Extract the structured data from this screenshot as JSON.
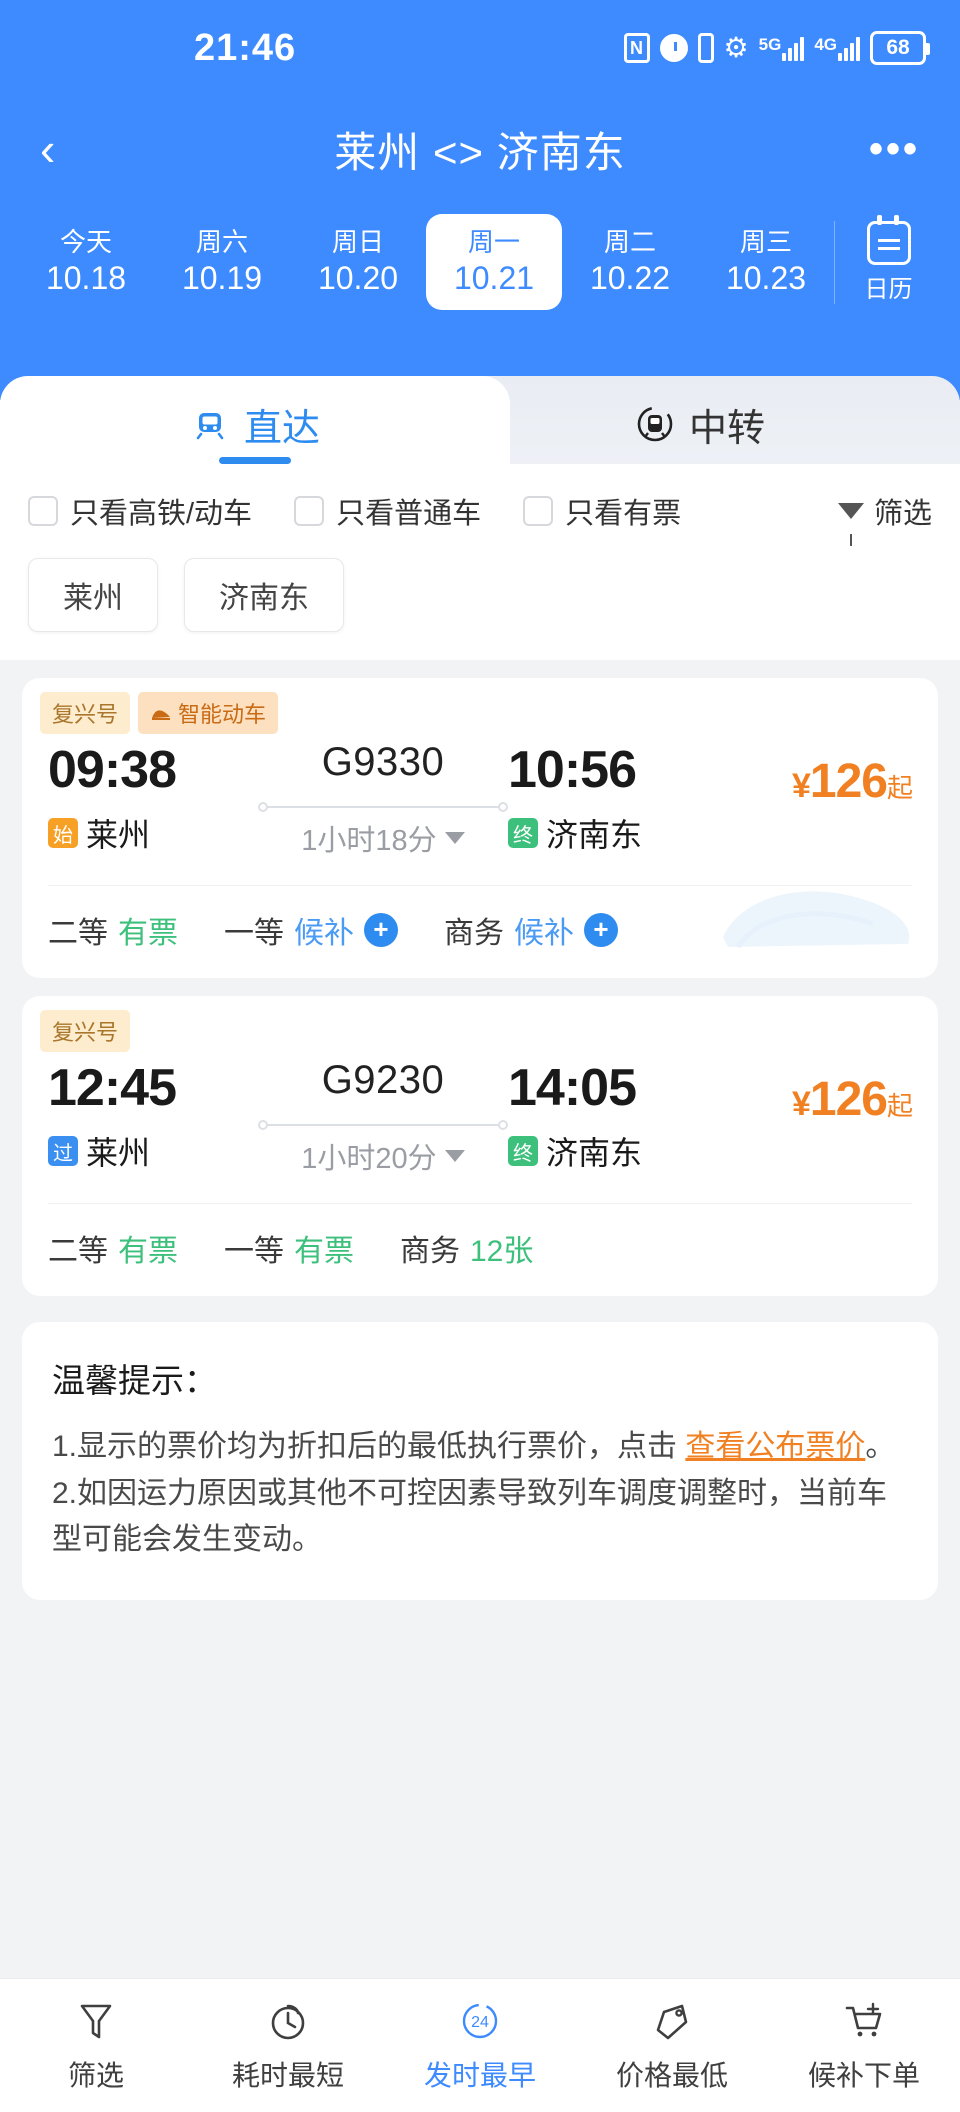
{
  "status_bar": {
    "time": "21:46",
    "battery": "68",
    "icons": [
      "nfc-icon",
      "alarm-icon",
      "vibrate-icon",
      "wifi-icon",
      "5g-signal-icon",
      "4g-signal-icon",
      "battery-icon"
    ],
    "net_5g": "5G",
    "net_4g": "4G"
  },
  "nav": {
    "back": "‹",
    "title": "莱州 <> 济南东",
    "more": "•••"
  },
  "dates": {
    "items": [
      {
        "week": "今天",
        "date": "10.18",
        "active": false
      },
      {
        "week": "周六",
        "date": "10.19",
        "active": false
      },
      {
        "week": "周日",
        "date": "10.20",
        "active": false
      },
      {
        "week": "周一",
        "date": "10.21",
        "active": true
      },
      {
        "week": "周二",
        "date": "10.22",
        "active": false
      },
      {
        "week": "周三",
        "date": "10.23",
        "active": false
      }
    ],
    "calendar_label": "日历"
  },
  "tabs": [
    {
      "label": "直达",
      "active": true
    },
    {
      "label": "中转",
      "active": false
    }
  ],
  "filters": {
    "checkboxes": [
      {
        "label": "只看高铁/动车",
        "checked": false
      },
      {
        "label": "只看普通车",
        "checked": false
      },
      {
        "label": "只看有票",
        "checked": false
      }
    ],
    "filter_label": "筛选"
  },
  "station_chips": [
    "莱州",
    "济南东"
  ],
  "trains": [
    {
      "badges": [
        {
          "text": "复兴号",
          "style": "cream"
        },
        {
          "text": "智能动车",
          "style": "deep",
          "icon": "train-icon"
        }
      ],
      "depart_time": "09:38",
      "train_no": "G9330",
      "arrive_time": "10:56",
      "price": "126",
      "price_yen": "¥",
      "price_suffix": "起",
      "from_badge": "始",
      "from_badge_type": "start",
      "from_station": "莱州",
      "duration": "1小时18分",
      "to_badge": "终",
      "to_badge_type": "end",
      "to_station": "济南东",
      "seats": [
        {
          "cls": "二等",
          "status": "有票",
          "type": "ok",
          "plus": false
        },
        {
          "cls": "一等",
          "status": "候补",
          "type": "wait",
          "plus": true
        },
        {
          "cls": "商务",
          "status": "候补",
          "type": "wait",
          "plus": true
        }
      ]
    },
    {
      "badges": [
        {
          "text": "复兴号",
          "style": "cream"
        }
      ],
      "depart_time": "12:45",
      "train_no": "G9230",
      "arrive_time": "14:05",
      "price": "126",
      "price_yen": "¥",
      "price_suffix": "起",
      "from_badge": "过",
      "from_badge_type": "pass",
      "from_station": "莱州",
      "duration": "1小时20分",
      "to_badge": "终",
      "to_badge_type": "end",
      "to_station": "济南东",
      "seats": [
        {
          "cls": "二等",
          "status": "有票",
          "type": "ok",
          "plus": false
        },
        {
          "cls": "一等",
          "status": "有票",
          "type": "ok",
          "plus": false
        },
        {
          "cls": "商务",
          "status": "12张",
          "type": "ok",
          "plus": false
        }
      ]
    }
  ],
  "tips": {
    "title": "温馨提示：",
    "item1_a": "1.显示的票价均为折扣后的最低执行票价，点击 ",
    "item1_link": "查看公布票价",
    "item1_b": "。",
    "item2": "2.如因运力原因或其他不可控因素导致列车调度调整时，当前车型可能会发生变动。"
  },
  "bottom_bar": [
    {
      "label": "筛选",
      "icon": "funnel-icon",
      "active": false
    },
    {
      "label": "耗时最短",
      "icon": "stopwatch-icon",
      "active": false
    },
    {
      "label": "发时最早",
      "icon": "clock-24-icon",
      "badge": "24",
      "active": true
    },
    {
      "label": "价格最低",
      "icon": "price-tag-icon",
      "active": false
    },
    {
      "label": "候补下单",
      "icon": "cart-plus-icon",
      "active": false
    }
  ],
  "colors": {
    "brand_blue": "#3e8bff",
    "price_orange": "#f08021",
    "available_green": "#3ec07d",
    "waitlist_blue": "#4b9bf5"
  }
}
